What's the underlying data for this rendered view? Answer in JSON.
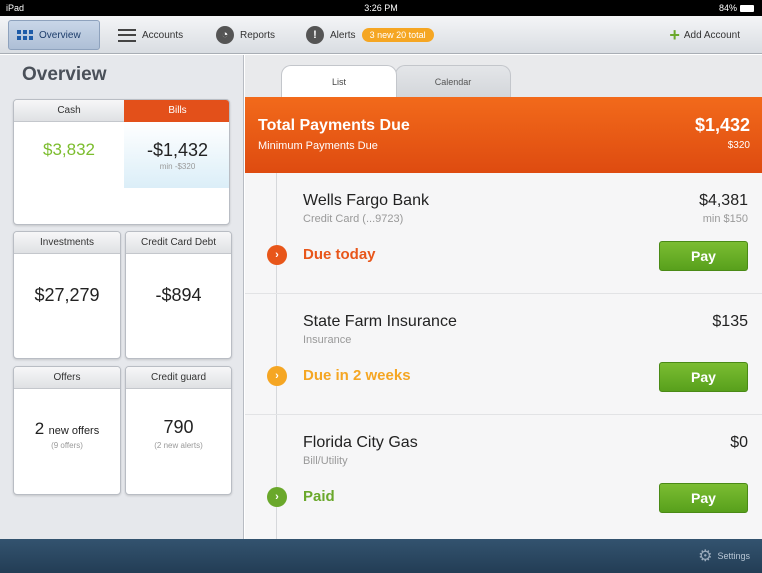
{
  "status_bar": {
    "device": "iPad",
    "time": "3:26 PM",
    "battery": "84%"
  },
  "nav": {
    "overview": "Overview",
    "accounts": "Accounts",
    "reports": "Reports",
    "alerts": "Alerts",
    "alerts_badge": "3 new 20 total",
    "add_account": "Add Account"
  },
  "overview": {
    "title": "Overview",
    "cash": {
      "label": "Cash",
      "value": "$3,832"
    },
    "bills": {
      "label": "Bills",
      "value": "-$1,432",
      "sub": "min -$320"
    },
    "investments": {
      "label": "Investments",
      "value": "$27,279"
    },
    "credit_card_debt": {
      "label": "Credit Card Debt",
      "value": "-$894"
    },
    "offers": {
      "label": "Offers",
      "value_num": "2",
      "value_text": "new offers",
      "sub": "(9 offers)"
    },
    "credit_guard": {
      "label": "Credit guard",
      "value": "790",
      "sub": "(2 new alerts)"
    }
  },
  "tabs": {
    "list": "List",
    "calendar": "Calendar"
  },
  "total": {
    "title": "Total Payments Due",
    "subtitle": "Minimum Payments Due",
    "amount": "$1,432",
    "min_amount": "$320"
  },
  "payments": [
    {
      "name": "Wells Fargo Bank",
      "type": "Credit Card (...9723)",
      "amount": "$4,381",
      "min": "min $150",
      "status": "Due today",
      "pay": "Pay"
    },
    {
      "name": "State Farm Insurance",
      "type": "Insurance",
      "amount": "$135",
      "min": "",
      "status": "Due in 2 weeks",
      "pay": "Pay"
    },
    {
      "name": "Florida City Gas",
      "type": "Bill/Utility",
      "amount": "$0",
      "min": "",
      "status": "Paid",
      "pay": "Pay"
    }
  ],
  "bottom": {
    "settings": "Settings"
  },
  "colors": {
    "accent_orange": "#e85a14",
    "due_today": "#e8561a",
    "due_soon": "#f5a623",
    "paid": "#6aa82b",
    "cash_green": "#7cbd2e"
  }
}
